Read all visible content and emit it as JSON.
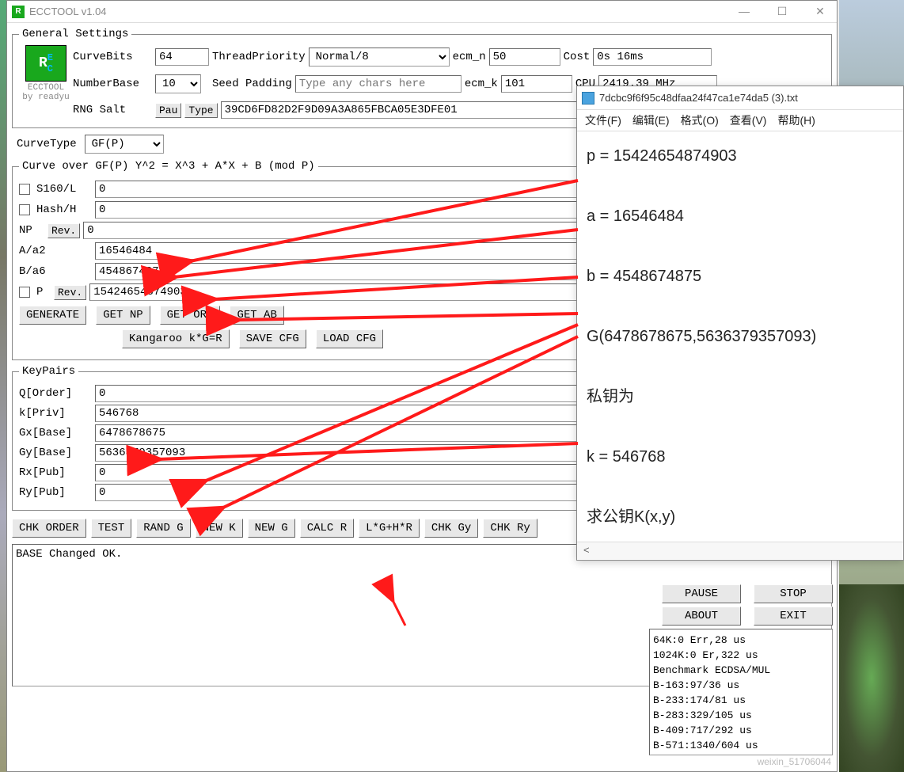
{
  "app": {
    "title": "ECCTOOL v1.04"
  },
  "logo": {
    "name": "ECCTOOL",
    "author": "by readyu"
  },
  "general": {
    "legend": "General Settings",
    "curvebits_label": "CurveBits",
    "curvebits": "64",
    "threadpriority_label": "ThreadPriority",
    "threadpriority": "Normal/8",
    "ecm_n_label": "ecm_n",
    "ecm_n": "50",
    "cost_label": "Cost",
    "cost": "0s 16ms",
    "numberbase_label": "NumberBase",
    "numberbase": "10",
    "seedpadding_label": "Seed Padding",
    "seedpadding_placeholder": "Type any chars here",
    "ecm_k_label": "ecm_k",
    "ecm_k": "101",
    "cpu_label": "CPU",
    "cpu": "2419.39 MHz",
    "rngsalt_label": "RNG Salt",
    "pau": "Pau",
    "type": "Type",
    "rngsalt": "39CD6FD82D2F9D09A3A865FBCA05E3DFE01"
  },
  "curvetype_label": "CurveType",
  "curvetype": "GF(P)",
  "curve": {
    "legend": "Curve over GF(P) Y^2 = X^3 + A*X + B (mod P)",
    "s160_label": "S160/L",
    "s160": "0",
    "hash_label": "Hash/H",
    "hash": "0",
    "np_label": "NP",
    "rev": "Rev.",
    "np": "0",
    "a_label": "A/a2",
    "a": "16546484",
    "b_label": "B/a6",
    "b": "4548674875",
    "p_label": "P",
    "p": "15424654874903",
    "buttons": {
      "generate": "GENERATE",
      "getnp": "GET NP",
      "getord": "GET ORD",
      "getab": "GET AB"
    },
    "buttons2": {
      "kang": "Kangaroo k*G=R",
      "savecfg": "SAVE CFG",
      "loadcfg": "LOAD CFG"
    }
  },
  "keypairs": {
    "legend": "KeyPairs",
    "q_label": "Q[Order]",
    "q": "0",
    "k_label": "k[Priv]",
    "k": "546768",
    "gx_label": "Gx[Base]",
    "gx": "6478678675",
    "gy_label": "Gy[Base]",
    "gy": "5636379357093",
    "rx_label": "Rx[Pub]",
    "rx": "0",
    "ry_label": "Ry[Pub]",
    "ry": "0"
  },
  "bottom_buttons": [
    "CHK ORDER",
    "TEST",
    "RAND G",
    "NEW K",
    "NEW G",
    "CALC R",
    "L*G+H*R",
    "CHK Gy",
    "CHK Ry"
  ],
  "log": "BASE Changed OK.",
  "side": {
    "pause": "PAUSE",
    "stop": "STOP",
    "about": "ABOUT",
    "exit": "EXIT",
    "bench": "64K:0 Err,28 us\n1024K:0 Er,322 us\nBenchmark ECDSA/MUL\nB-163:97/36 us\nB-233:174/81 us\nB-283:329/105 us\nB-409:717/292 us\nB-571:1340/604 us"
  },
  "notepad": {
    "title": "7dcbc9f6f95c48dfaa24f47ca1e74da5 (3).txt",
    "menu": [
      "文件(F)",
      "编辑(E)",
      "格式(O)",
      "查看(V)",
      "帮助(H)"
    ],
    "lines": [
      "p = 15424654874903",
      "",
      "a = 16546484",
      "",
      "b = 4548674875",
      "",
      "G(6478678675,5636379357093)",
      "",
      "私钥为",
      "",
      "k = 546768",
      "",
      "求公钥K(x,y)"
    ],
    "status_left": "<"
  },
  "watermark": "weixin_51706044"
}
